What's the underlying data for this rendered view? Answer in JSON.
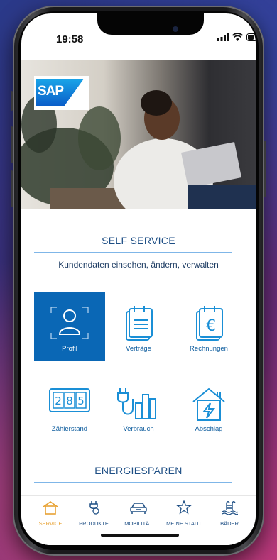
{
  "status_bar": {
    "time": "19:58"
  },
  "hero": {
    "brand": "SAP"
  },
  "self_service": {
    "title": "SELF SERVICE",
    "subtitle": "Kundendaten einsehen, ändern, verwalten",
    "tiles": [
      {
        "label": "Profil",
        "icon": "user-icon",
        "active": true
      },
      {
        "label": "Verträge",
        "icon": "contract-document-icon"
      },
      {
        "label": "Rechnungen",
        "icon": "invoice-euro-icon"
      },
      {
        "label": "Zählerstand",
        "icon": "meter-counter-icon"
      },
      {
        "label": "Verbrauch",
        "icon": "plug-consumption-icon"
      },
      {
        "label": "Abschlag",
        "icon": "house-energy-icon"
      }
    ]
  },
  "energy": {
    "title": "ENERGIESPAREN"
  },
  "tabbar": {
    "items": [
      {
        "label": "SERVICE",
        "icon": "house-icon",
        "active": true
      },
      {
        "label": "PRODUKTE",
        "icon": "plug-icon"
      },
      {
        "label": "MOBILITÄT",
        "icon": "car-icon"
      },
      {
        "label": "MEINE STADT",
        "icon": "star-icon"
      },
      {
        "label": "BÄDER",
        "icon": "pool-icon"
      }
    ]
  },
  "colors": {
    "brand_blue": "#0a67b5",
    "accent": "#e8a233",
    "text_blue": "#1d4e84"
  }
}
